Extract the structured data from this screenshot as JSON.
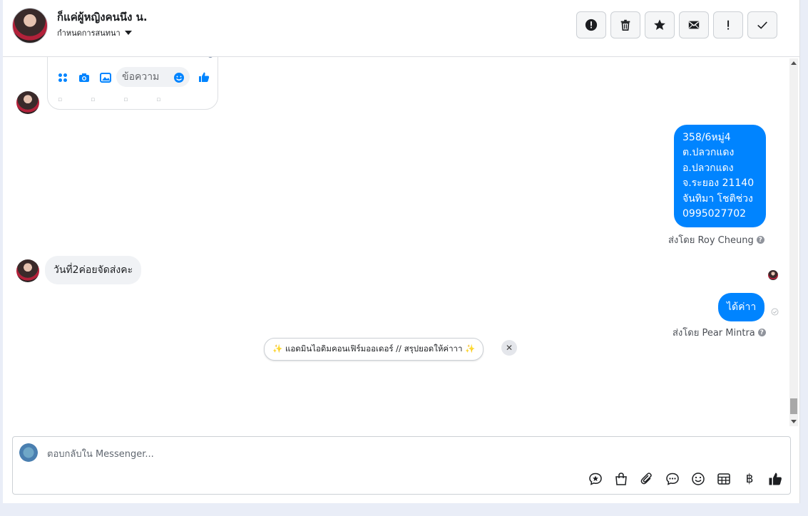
{
  "header": {
    "contact_name": "ก็แค่ผู้หญิงคนนึง น.",
    "assign_label": "กำหนดการสนทนา",
    "actions": [
      {
        "name": "spam",
        "symbol": "!"
      },
      {
        "name": "delete"
      },
      {
        "name": "star"
      },
      {
        "name": "mark-unread"
      },
      {
        "name": "important",
        "symbol": "!"
      },
      {
        "name": "done"
      }
    ]
  },
  "screenshot_preview": {
    "input_placeholder": "ข้อความ"
  },
  "messages": {
    "address_lines": [
      "358/6หมู่4",
      "ต.ปลวกแดง",
      "อ.ปลวกแดง",
      "จ.ระยอง 21140",
      "จันทิมา โชติช่วง",
      "0995027702"
    ],
    "sent_by_1": "ส่งโดย Roy Cheung",
    "incoming_text": "วันที่2ค่อยจัดส่งคะ",
    "reply_text": "ได้ค่าา",
    "sent_by_2": "ส่งโดย Pear Mintra",
    "help_symbol": "?"
  },
  "suggestion": {
    "text": "✨ แอดมินไอดิมคอนเฟิร์มออเดอร์ // สรุปยอดให้ค่าาา ✨",
    "close_symbol": "✕"
  },
  "composer": {
    "placeholder": "ตอบกลับใน Messenger...",
    "baht_symbol": "฿"
  },
  "colors": {
    "accent": "#0084ff",
    "bubble_in": "#f0f2f5"
  }
}
